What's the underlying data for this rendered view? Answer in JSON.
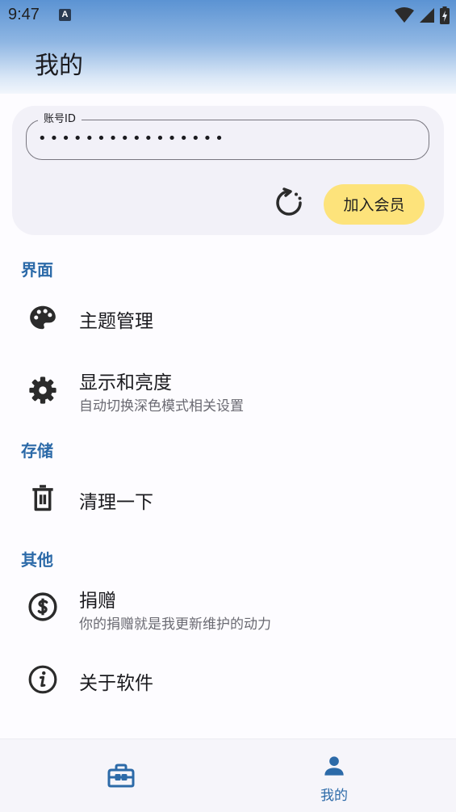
{
  "status_bar": {
    "time": "9:47",
    "notification_badge": "A"
  },
  "header": {
    "title": "我的"
  },
  "account": {
    "field_label": "账号ID",
    "field_value": "••••••••••••••••",
    "refresh_icon": "refresh-icon",
    "join_button": "加入会员"
  },
  "sections": {
    "interface": "界面",
    "storage": "存储",
    "other": "其他"
  },
  "items": {
    "theme": {
      "icon": "palette-icon",
      "title": "主题管理"
    },
    "display": {
      "icon": "gear-icon",
      "title": "显示和亮度",
      "subtitle": "自动切换深色模式相关设置"
    },
    "cleanup": {
      "icon": "trash-icon",
      "title": "清理一下"
    },
    "donate": {
      "icon": "dollar-circle-icon",
      "title": "捐赠",
      "subtitle": "你的捐赠就是我更新维护的动力"
    },
    "about": {
      "icon": "info-icon",
      "title": "关于软件"
    }
  },
  "bottom_nav": {
    "tabs": [
      {
        "icon": "toolbox-icon",
        "label": ""
      },
      {
        "icon": "person-icon",
        "label": "我的"
      }
    ],
    "active_color": "#2c6aa8"
  }
}
